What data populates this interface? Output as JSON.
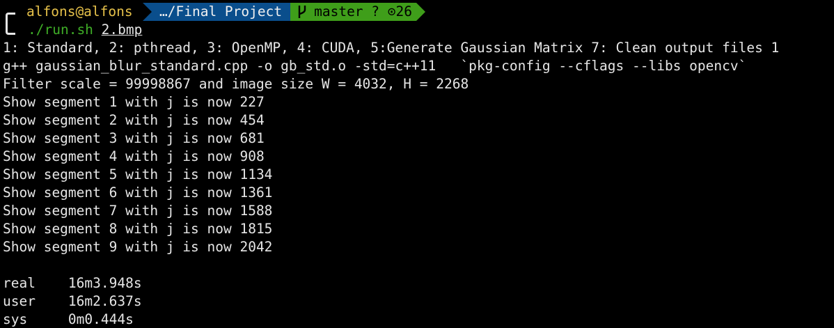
{
  "prompt": {
    "user_host": "alfons@alfons",
    "path": "…/Final Project",
    "git_branch": "master ? ⊙26"
  },
  "command": {
    "program": "./run.sh",
    "argument": "2.bmp"
  },
  "output": [
    "1: Standard, 2: pthread, 3: OpenMP, 4: CUDA, 5:Generate Gaussian Matrix 7: Clean output files 1",
    "g++ gaussian_blur_standard.cpp -o gb_std.o -std=c++11   `pkg-config --cflags --libs opencv`",
    "Filter scale = 99998867 and image size W = 4032, H = 2268",
    "Show segment 1 with j is now 227",
    "Show segment 2 with j is now 454",
    "Show segment 3 with j is now 681",
    "Show segment 4 with j is now 908",
    "Show segment 5 with j is now 1134",
    "Show segment 6 with j is now 1361",
    "Show segment 7 with j is now 1588",
    "Show segment 8 with j is now 1815",
    "Show segment 9 with j is now 2042",
    "",
    "real    16m3.948s",
    "user    16m2.637s",
    "sys     0m0.444s"
  ],
  "colors": {
    "background": "#000000",
    "text": "#e6e6e6",
    "user_host": "#e6c14a",
    "path_segment": "#0a4e8c",
    "git_segment": "#3f9e1a",
    "command": "#3fae27"
  }
}
